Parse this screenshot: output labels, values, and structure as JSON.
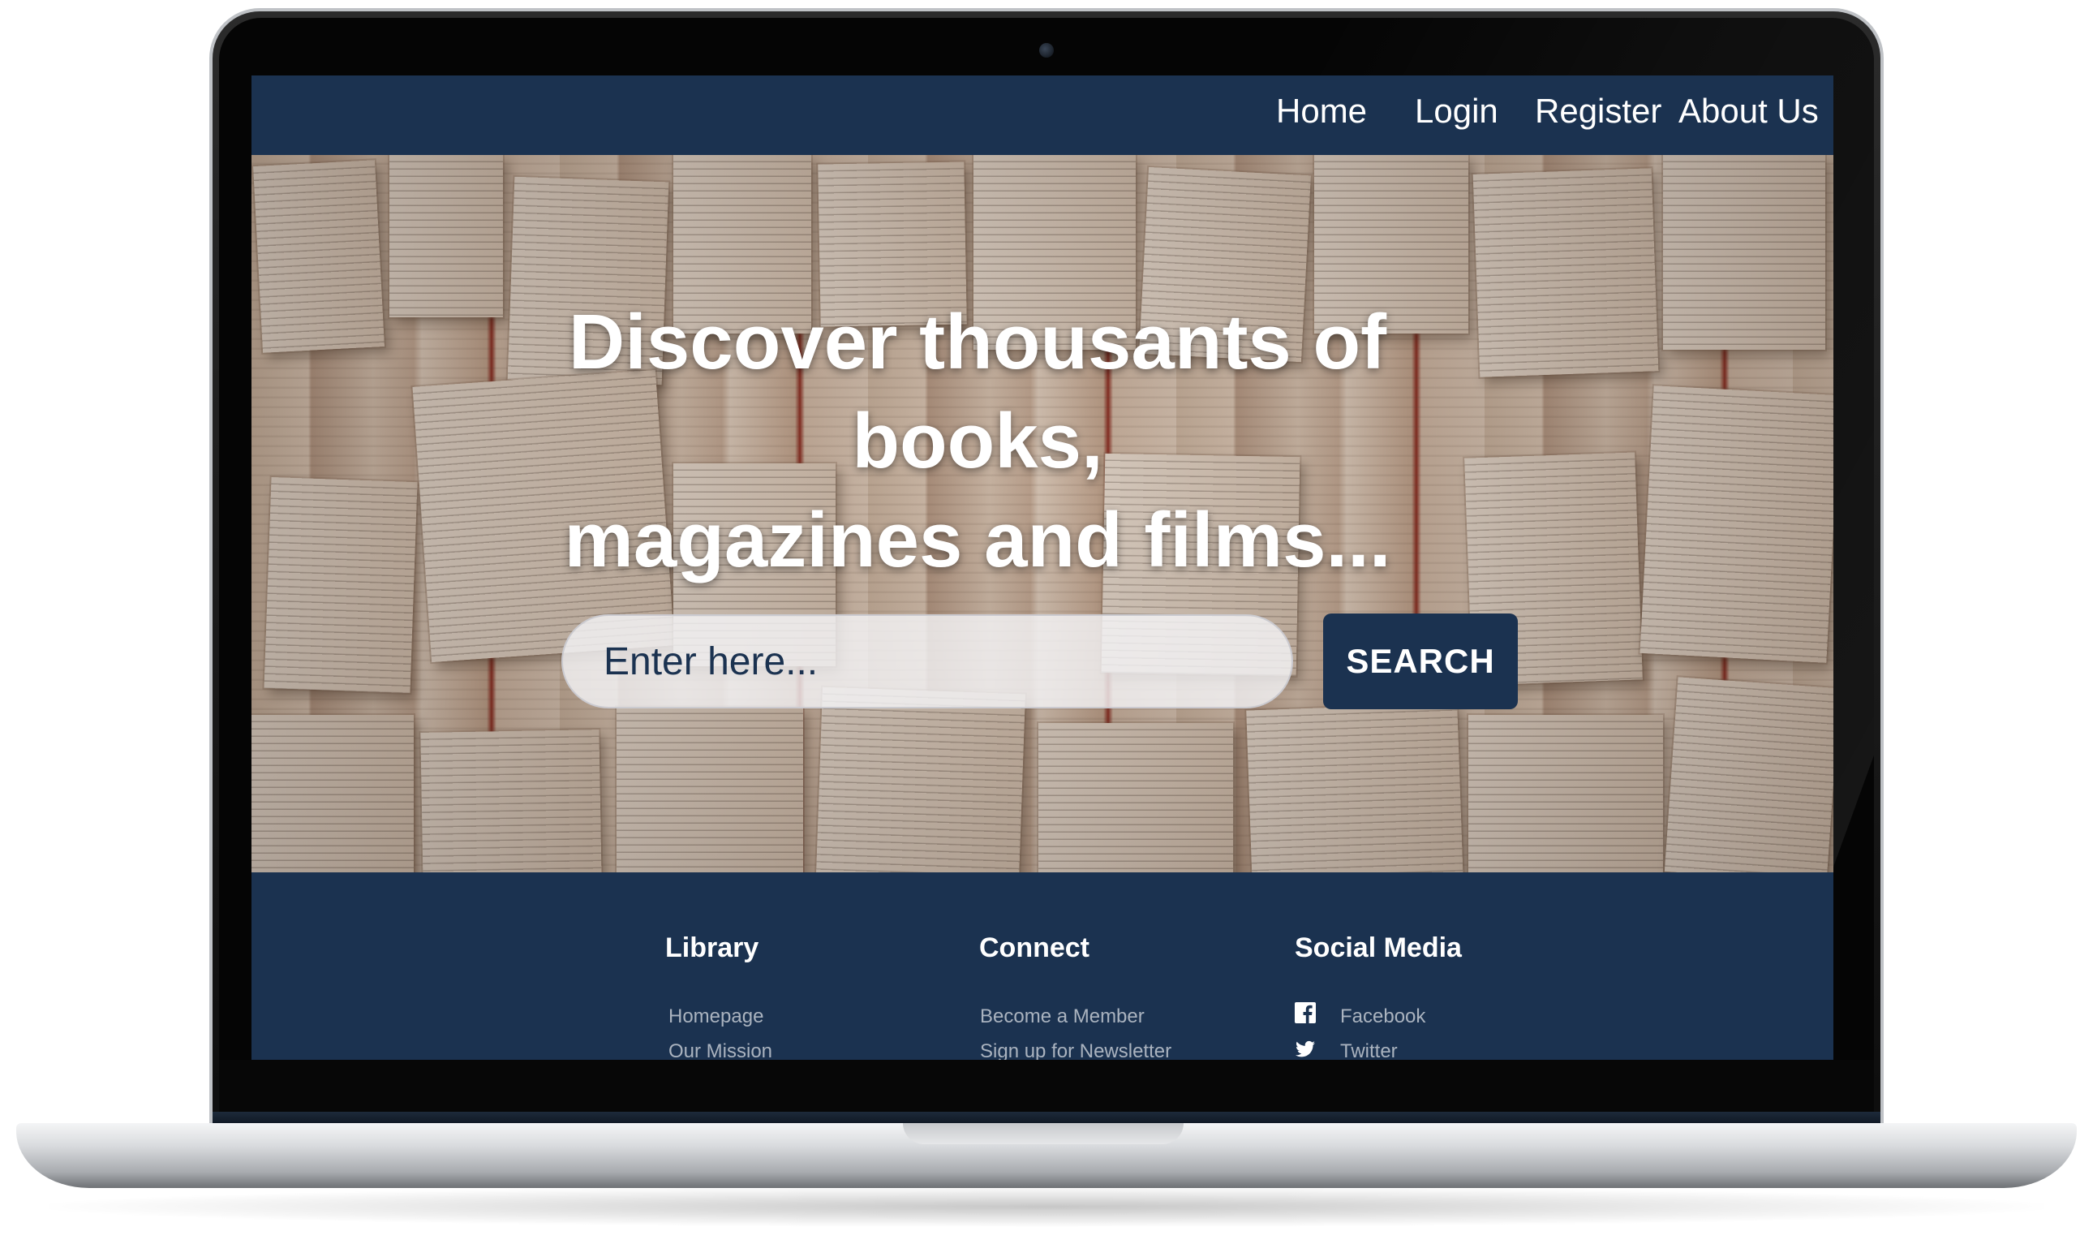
{
  "nav": {
    "items": [
      {
        "label": "Home"
      },
      {
        "label": "Login"
      },
      {
        "label": "Register"
      },
      {
        "label": "About Us"
      }
    ]
  },
  "hero": {
    "title_line1": "Discover thousants of books,",
    "title_line2": "magazines and films...",
    "search_placeholder": "Enter here...",
    "search_button": "SEARCH"
  },
  "footer": {
    "columns": [
      {
        "heading": "Library",
        "links": [
          "Homepage",
          "Our Mission"
        ]
      },
      {
        "heading": "Connect",
        "links": [
          "Become a Member",
          "Sign up for Newsletter"
        ]
      },
      {
        "heading": "Social Media",
        "links": [
          "Facebook",
          "Twitter"
        ]
      }
    ]
  },
  "icons": {
    "facebook": "facebook-icon",
    "twitter": "twitter-icon"
  },
  "colors": {
    "brand_navy": "#1b3250",
    "footer_link": "#aab3bf",
    "text_light": "#ffffff"
  }
}
